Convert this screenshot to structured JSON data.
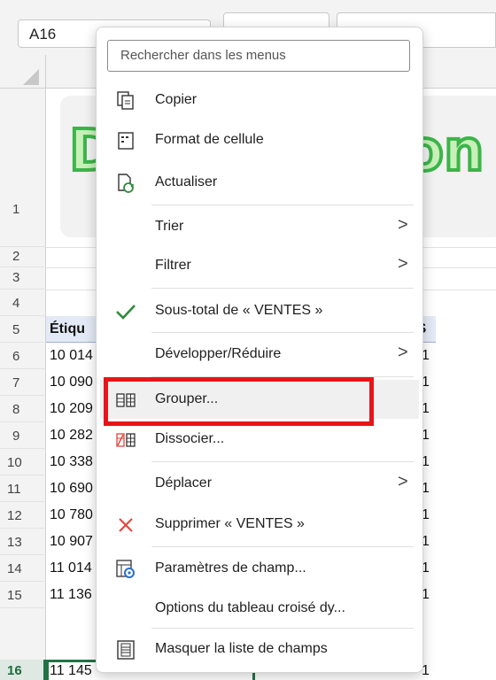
{
  "formula_bar": {
    "name_box": "A16"
  },
  "grid": {
    "rows": [
      "1",
      "2",
      "3",
      "4",
      "5",
      "6",
      "7",
      "8",
      "9",
      "10",
      "11",
      "12",
      "13",
      "14",
      "15",
      "16"
    ],
    "active_row": "16",
    "title_left": "D",
    "title_right": "on",
    "header_col_a": "Étiqu",
    "header_col_right": "ES",
    "data_col_a": [
      "10 014",
      "10 090",
      "10 209",
      "10 282",
      "10 338",
      "10 690",
      "10 780",
      "10 907",
      "11 014",
      "11 136",
      "11 145"
    ],
    "data_col_right": [
      "1",
      "1",
      "1",
      "1",
      "1",
      "1",
      "1",
      "1",
      "1",
      "1",
      "1"
    ]
  },
  "context_menu": {
    "search_placeholder": "Rechercher dans les menus",
    "items": [
      {
        "label": "Copier",
        "icon": "copy-icon"
      },
      {
        "label": "Format de cellule",
        "icon": "format-cells-icon"
      },
      {
        "label": "Actualiser",
        "icon": "refresh-icon"
      },
      {
        "label": "Trier",
        "icon": "",
        "submenu": ">"
      },
      {
        "label": "Filtrer",
        "icon": "",
        "submenu": ">"
      },
      {
        "label": "Sous-total de « VENTES »",
        "icon": "checkmark-icon"
      },
      {
        "label": "Développer/Réduire",
        "icon": "",
        "submenu": ">"
      },
      {
        "label": "Grouper...",
        "icon": "group-icon"
      },
      {
        "label": "Dissocier...",
        "icon": "ungroup-icon"
      },
      {
        "label": "Déplacer",
        "icon": "",
        "submenu": ">"
      },
      {
        "label": "Supprimer « VENTES »",
        "icon": "delete-x-icon"
      },
      {
        "label": "Paramètres de champ...",
        "icon": "field-settings-icon"
      },
      {
        "label": "Options du tableau croisé dy...",
        "icon": ""
      },
      {
        "label": "Masquer la liste de champs",
        "icon": "field-list-icon"
      }
    ]
  },
  "colors": {
    "highlight_red": "#e8141a",
    "check_green": "#2e8b3c",
    "delete_red": "#e0453c",
    "excel_green": "#217346"
  }
}
